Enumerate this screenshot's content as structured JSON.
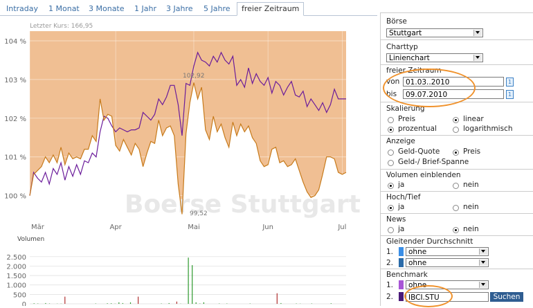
{
  "tabs": [
    "Intraday",
    "1 Monat",
    "3 Monate",
    "1 Jahr",
    "3 Jahre",
    "5 Jahre",
    "freier Zeitraum"
  ],
  "active_tab": "freier Zeitraum",
  "chart_data": [
    {
      "type": "line",
      "title": "Letzter Kurs: 166,95",
      "xlabel": "",
      "ylabel": "",
      "x_ticks": [
        "Mär",
        "Apr",
        "Mai",
        "Jun",
        "Jul"
      ],
      "y_ticks": [
        "100 %",
        "101 %",
        "102 %",
        "103 %",
        "104 %"
      ],
      "ylim": [
        99.35,
        104.25
      ],
      "annotations": [
        "102,92",
        "99,52"
      ],
      "watermark": "Boerse Stuttgart",
      "grid": true,
      "series": [
        {
          "color": "#6a1b9a",
          "values": [
            100.0,
            100.6,
            100.45,
            100.35,
            100.6,
            100.3,
            100.7,
            100.55,
            100.85,
            100.4,
            100.75,
            100.5,
            100.8,
            100.55,
            100.9,
            100.85,
            101.1,
            101.0,
            101.65,
            102.05,
            102.0,
            101.8,
            101.65,
            101.75,
            101.7,
            101.65,
            101.7,
            101.7,
            101.75,
            102.15,
            102.05,
            101.95,
            102.1,
            102.5,
            102.35,
            102.55,
            102.85,
            102.85,
            102.35,
            101.55,
            102.9,
            102.85,
            103.35,
            103.7,
            103.5,
            103.45,
            103.35,
            103.6,
            103.45,
            103.7,
            103.5,
            103.4,
            103.6,
            102.85,
            103.0,
            102.8,
            103.3,
            102.9,
            103.15,
            102.95,
            102.85,
            103.05,
            102.65,
            102.95,
            102.85,
            102.6,
            102.8,
            102.95,
            102.6,
            102.55,
            102.7,
            102.3,
            102.5,
            102.35,
            102.2,
            102.4,
            102.15,
            102.35,
            102.75,
            102.5,
            102.5,
            102.5
          ]
        },
        {
          "color": "#c77a1a",
          "values": [
            100.0,
            100.55,
            100.65,
            100.75,
            101.0,
            100.85,
            101.05,
            100.85,
            101.25,
            100.8,
            101.1,
            100.95,
            101.0,
            100.95,
            101.2,
            101.2,
            101.55,
            101.4,
            102.5,
            101.95,
            102.1,
            102.05,
            101.3,
            101.15,
            101.45,
            101.25,
            101.05,
            101.35,
            101.2,
            100.75,
            101.1,
            101.4,
            101.35,
            101.95,
            101.55,
            101.75,
            101.8,
            101.55,
            100.3,
            99.52,
            101.6,
            102.4,
            102.92,
            102.5,
            102.8,
            101.7,
            101.45,
            102.05,
            101.65,
            101.85,
            101.5,
            101.25,
            101.9,
            101.55,
            101.85,
            101.65,
            101.8,
            101.5,
            101.35,
            100.9,
            100.75,
            100.8,
            101.2,
            101.25,
            100.85,
            100.9,
            100.75,
            100.8,
            100.95,
            100.65,
            100.35,
            100.1,
            99.95,
            100.0,
            100.15,
            100.55,
            101.0,
            101.0,
            100.95,
            100.6,
            100.55,
            100.6
          ]
        }
      ]
    },
    {
      "type": "bar",
      "title": "Volumen",
      "y_ticks": [
        "0",
        "500",
        "1.000",
        "1.500",
        "2.000",
        "2.500"
      ],
      "ylim": [
        0,
        2750
      ],
      "values": [
        0,
        30,
        20,
        0,
        40,
        20,
        0,
        10,
        10,
        380,
        0,
        0,
        0,
        0,
        0,
        0,
        0,
        20,
        0,
        0,
        30,
        30,
        10,
        80,
        40,
        0,
        80,
        0,
        380,
        0,
        0,
        0,
        0,
        0,
        20,
        0,
        40,
        0,
        120,
        10,
        0,
        2450,
        2050,
        80,
        20,
        80,
        0,
        0,
        0,
        20,
        0,
        20,
        0,
        0,
        0,
        0,
        0,
        20,
        0,
        0,
        0,
        0,
        0,
        0,
        560,
        40,
        0,
        0,
        0,
        20,
        10,
        0,
        0,
        20,
        0,
        0,
        0,
        0,
        30,
        0,
        0,
        0,
        0
      ],
      "colors_note": "green bars, some red"
    }
  ],
  "panel": {
    "boerse": {
      "title": "Börse",
      "value": "Stuttgart"
    },
    "charttyp": {
      "title": "Charttyp",
      "value": "Linienchart"
    },
    "zeitraum": {
      "title": "freier Zeitraum",
      "von_label": "von",
      "von": "01.03..2010",
      "bis_label": "bis",
      "bis": "09.07.2010",
      "cal_icon": "1"
    },
    "skalierung": {
      "title": "Skalierung",
      "opt1": "Preis",
      "opt2": "linear",
      "opt3": "prozentual",
      "opt4": "logarithmisch"
    },
    "anzeige": {
      "title": "Anzeige",
      "opt1": "Geld-Quote",
      "opt2": "Preis",
      "opt3": "Geld-/ Brief-Spanne"
    },
    "volumen": {
      "title": "Volumen einblenden",
      "ja": "ja",
      "nein": "nein"
    },
    "hochtief": {
      "title": "Hoch/Tief",
      "ja": "ja",
      "nein": "nein"
    },
    "news": {
      "title": "News",
      "ja": "ja",
      "nein": "nein"
    },
    "gd": {
      "title": "Gleitender Durchschnitt",
      "n1": "1.",
      "v1": "ohne",
      "n2": "2.",
      "v2": "ohne",
      "c1": "#3a8ee6",
      "c2": "#2a6aa8"
    },
    "benchmark": {
      "title": "Benchmark",
      "n1": "1.",
      "v1": "ohne",
      "n2": "2.",
      "v2": "IBCI.STU",
      "button": "Suchen",
      "c1": "#a855d6",
      "c2": "#4a1a7a"
    }
  }
}
